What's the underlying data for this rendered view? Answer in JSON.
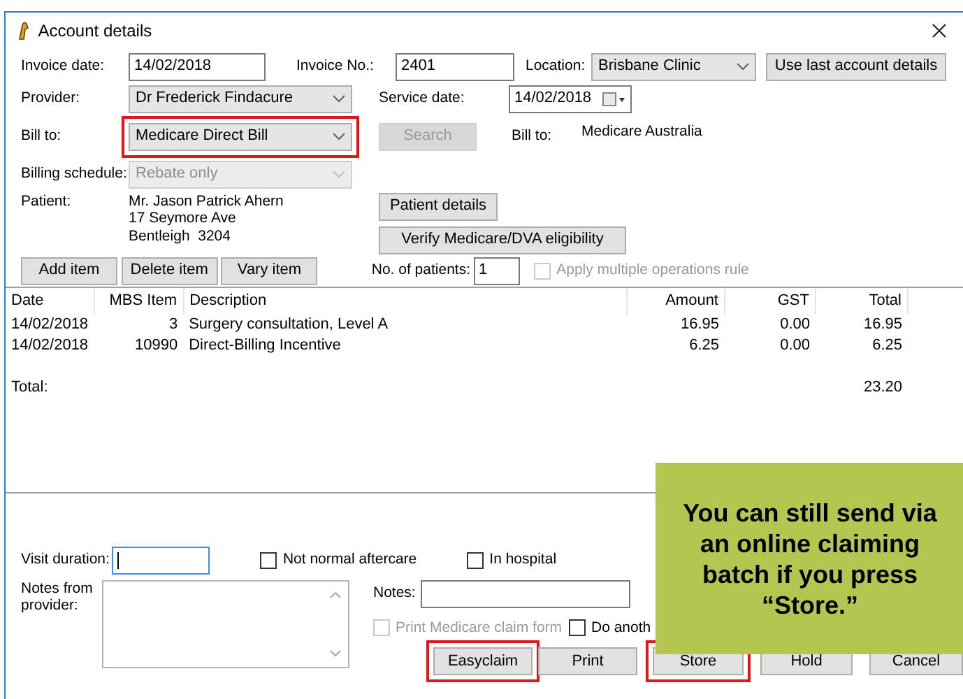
{
  "window": {
    "title": "Account details"
  },
  "invoice": {
    "date_label": "Invoice date:",
    "date": "14/02/2018",
    "no_label": "Invoice No.:",
    "no": "2401",
    "location_label": "Location:",
    "location": "Brisbane Clinic",
    "use_last_button": "Use last account details"
  },
  "provider": {
    "label": "Provider:",
    "value": "Dr Frederick Findacure"
  },
  "service_date": {
    "label": "Service date:",
    "value": "14/02/2018"
  },
  "bill_to": {
    "label": "Bill to:",
    "value": "Medicare Direct Bill",
    "highlighted": true
  },
  "search_button": {
    "label": "Search",
    "disabled": true
  },
  "bill_to_info": {
    "label": "Bill to:",
    "value": "Medicare Australia"
  },
  "billing_schedule": {
    "label": "Billing schedule:",
    "value": "Rebate only",
    "disabled": true
  },
  "patient": {
    "label": "Patient:",
    "lines": [
      "Mr. Jason Patrick Ahern",
      "17 Seymore Ave",
      "Bentleigh  3204"
    ]
  },
  "patient_buttons": [
    "Patient details",
    "Verify Medicare/DVA eligibility"
  ],
  "item_buttons": [
    "Add item",
    "Delete item",
    "Vary item"
  ],
  "patients_count": {
    "label": "No. of patients:",
    "value": "1"
  },
  "multiple_ops": {
    "label": "Apply multiple operations rule",
    "checked": false,
    "disabled": true
  },
  "table": {
    "columns": [
      "Date",
      "MBS Item",
      "Description",
      "Amount",
      "GST",
      "Total"
    ],
    "rows": [
      [
        "14/02/2018",
        "3",
        "Surgery consultation, Level A",
        "16.95",
        "0.00",
        "16.95"
      ],
      [
        "14/02/2018",
        "10990",
        "Direct-Billing Incentive",
        "6.25",
        "0.00",
        "6.25"
      ]
    ],
    "total_label": "Total:",
    "total": "23.20"
  },
  "visit_duration": {
    "label": "Visit duration:"
  },
  "flags": [
    {
      "label": "Not normal aftercare",
      "checked": false
    },
    {
      "label": "In hospital",
      "checked": false
    }
  ],
  "notes_from_provider": {
    "label": "Notes from provider:"
  },
  "notes": {
    "label": "Notes:"
  },
  "print_claim": {
    "label": "Print Medicare claim form",
    "checked": false,
    "disabled": true
  },
  "do_another": {
    "label": "Do anoth",
    "checked": false,
    "disabled": false
  },
  "actions": [
    {
      "label": "Easyclaim",
      "highlighted": true
    },
    {
      "label": "Print",
      "highlighted": false
    },
    {
      "label": "Store",
      "highlighted": true
    },
    {
      "label": "Hold",
      "highlighted": false
    },
    {
      "label": "Cancel",
      "highlighted": false
    }
  ],
  "callout": {
    "text": "You can still send via an online claiming batch if you press “Store.”"
  }
}
